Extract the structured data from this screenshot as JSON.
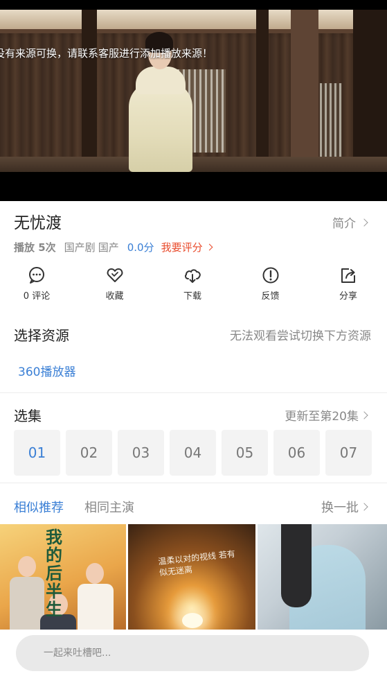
{
  "player": {
    "notice": "没有来源可换，请联系客服进行添加播放来源！"
  },
  "info": {
    "title": "无忧渡",
    "intro_label": "简介",
    "play_count": "播放 5次",
    "tags": [
      "国产剧",
      "国产"
    ],
    "score": "0.0分",
    "rate_label": "我要评分"
  },
  "actions": [
    {
      "icon": "comment-icon",
      "label": "0 评论"
    },
    {
      "icon": "heart-icon",
      "label": "收藏"
    },
    {
      "icon": "cloud-download-icon",
      "label": "下载"
    },
    {
      "icon": "alert-icon",
      "label": "反馈"
    },
    {
      "icon": "share-icon",
      "label": "分享"
    }
  ],
  "source": {
    "title": "选择资源",
    "hint": "无法观看尝试切换下方资源",
    "items": [
      "360播放器"
    ]
  },
  "episodes": {
    "title": "选集",
    "update_label": "更新至第20集",
    "list": [
      "01",
      "02",
      "03",
      "04",
      "05",
      "06",
      "07"
    ],
    "active": "01"
  },
  "recommend": {
    "tabs": [
      "相似推荐",
      "相同主演"
    ],
    "refresh_label": "换一批",
    "posters": [
      {
        "title_text": "我的后半生"
      },
      {
        "overlay_text": "温柔以对的视线 若有似无迷离"
      },
      {}
    ]
  },
  "comment": {
    "placeholder": "一起来吐槽吧..."
  },
  "colors": {
    "accent": "#3a7fd5",
    "rate": "#e94b2c",
    "muted": "#888888"
  }
}
